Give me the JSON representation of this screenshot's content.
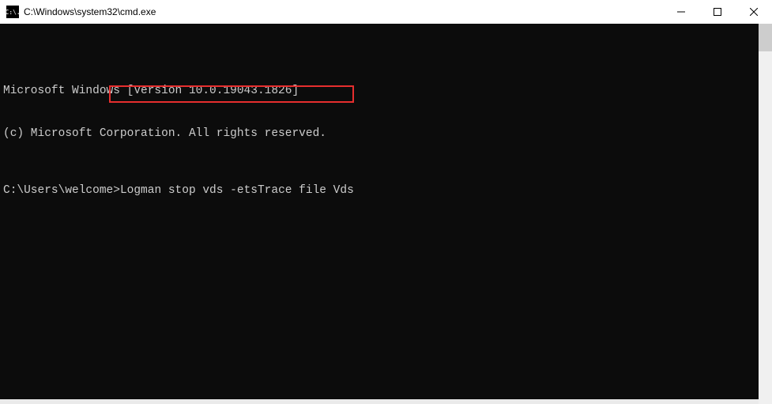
{
  "titlebar": {
    "icon_text": "C:\\.",
    "title": "C:\\Windows\\system32\\cmd.exe"
  },
  "terminal": {
    "line1": "Microsoft Windows [Version 10.0.19043.1826]",
    "line2": "(c) Microsoft Corporation. All rights reserved.",
    "prompt": "C:\\Users\\welcome>",
    "command": "Logman stop vds -etsTrace file Vds"
  }
}
